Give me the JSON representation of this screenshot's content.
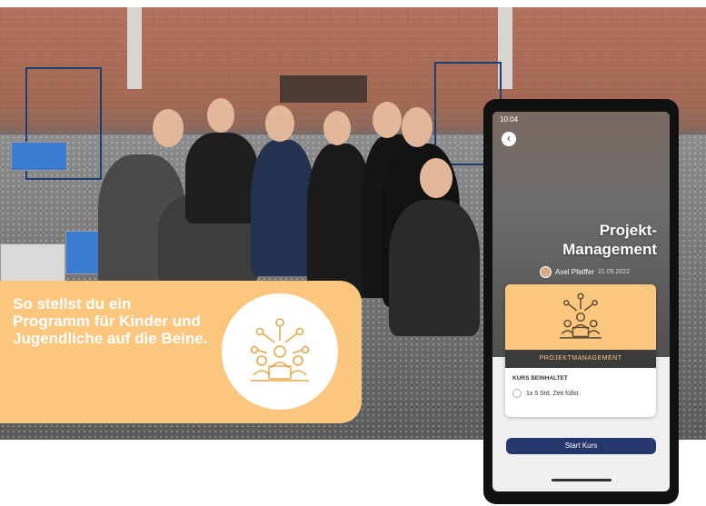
{
  "promo": {
    "headline": "So stellst du ein Programm für Kinder und Jugendliche auf die Beine.",
    "icon": "team-network-icon"
  },
  "phone": {
    "status_time": "10:04",
    "back_icon": "chevron-left-icon",
    "title": "Projekt-Management",
    "author": "Axel Pfeiffer",
    "date": "21.05.2022",
    "course": {
      "banner": "PROJEKTMANAGEMENT",
      "section": "KURS BEINHALTET",
      "item": "1x 5 Std. Zeit füllst",
      "start_label": "Start Kurs"
    }
  },
  "colors": {
    "accent": "#fbc67e",
    "button": "#26386b",
    "banner": "#3b3b3b"
  }
}
